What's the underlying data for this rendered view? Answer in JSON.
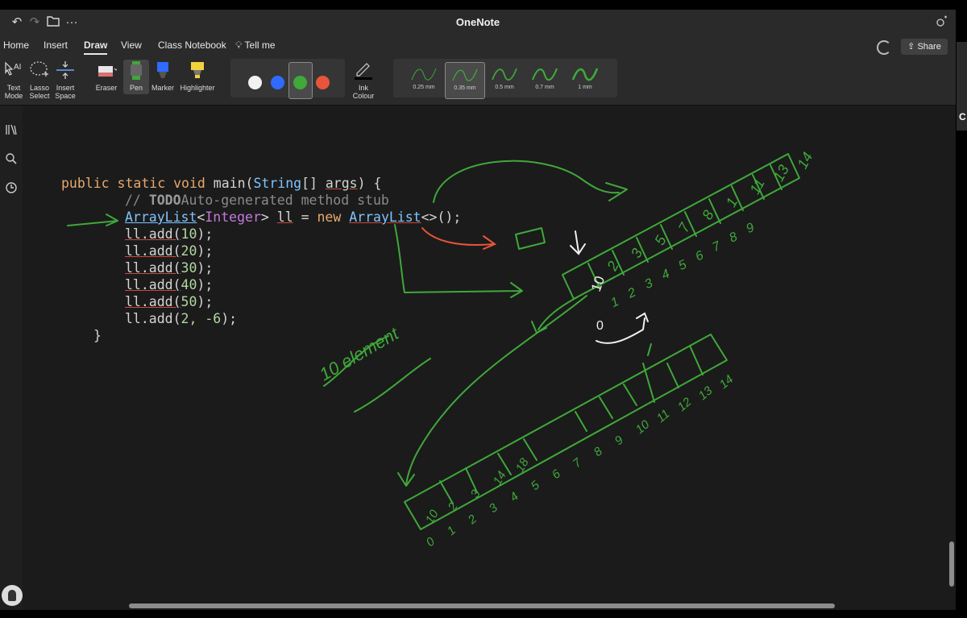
{
  "window": {
    "title": "OneNote"
  },
  "titlebar": {
    "undo_icon": "undo-icon",
    "redo_icon": "redo-icon",
    "folder_icon": "folder-icon",
    "more": "···"
  },
  "menu": {
    "items": [
      "Home",
      "Insert",
      "Draw",
      "View",
      "Class Notebook"
    ],
    "active": "Draw",
    "tell_me": "Tell me",
    "share": "Share"
  },
  "ribbon": {
    "text_mode": [
      "Text",
      "Mode"
    ],
    "lasso_select": [
      "Lasso",
      "Select"
    ],
    "insert_space": [
      "Insert",
      "Space"
    ],
    "eraser": "Eraser",
    "pen": "Pen",
    "marker": "Marker",
    "highlighter": "Highlighter",
    "colors": [
      "#f2f2f2",
      "#2f6bff",
      "#3fa83a",
      "#e8553a"
    ],
    "selected_color_index": 2,
    "ink_colour": [
      "Ink",
      "Colour"
    ],
    "thickness": [
      "0.25 mm",
      "0.35 mm",
      "0.5 mm",
      "0.7 mm",
      "1 mm"
    ],
    "selected_thickness": "0.35 mm"
  },
  "code": {
    "signature": {
      "kw1": "public",
      "kw2": "static",
      "kw3": "void",
      "name": "main(",
      "type": "String",
      "rest": "[] ",
      "param": "args",
      "end": ") {"
    },
    "comment": {
      "slashes": "// ",
      "todo": "TODO",
      "text": "Auto-generated method stub"
    },
    "decl": {
      "type": "ArrayList",
      "lt": "<",
      "generic": "Integer",
      "gt": "> ",
      "var": "ll",
      "eq": " = ",
      "new": "new",
      "sp": " ",
      "type2": "ArrayList",
      "tail": "<>();"
    },
    "adds": [
      {
        "call": "ll.add(",
        "arg": "10",
        "end": ");"
      },
      {
        "call": "ll.add(",
        "arg": "20",
        "end": ");"
      },
      {
        "call": "ll.add(",
        "arg": "30",
        "end": ");"
      },
      {
        "call": "ll.add(",
        "arg": "40",
        "end": ");"
      },
      {
        "call": "ll.add(",
        "arg": "50",
        "end": ");"
      },
      {
        "call": "ll.add(",
        "arg": "2, -6",
        "end": ");"
      }
    ],
    "close": "}"
  },
  "ink": {
    "note": "10 element",
    "top_boxes": [
      "10",
      "2",
      "3",
      "5",
      "7",
      "8",
      "1",
      "11",
      "13",
      "14"
    ],
    "top_indices": [
      "0",
      "1",
      "2",
      "3",
      "4",
      "5",
      "6",
      "7",
      "8",
      "9"
    ],
    "bottom_boxes": [
      "10",
      "2",
      "3",
      "14",
      "18"
    ],
    "bottom_indices": [
      "0",
      "1",
      "2",
      "3",
      "4",
      "5",
      "6",
      "7",
      "8",
      "9",
      "10",
      "11",
      "12",
      "13",
      "14"
    ]
  },
  "edge": {
    "letter": "C"
  }
}
